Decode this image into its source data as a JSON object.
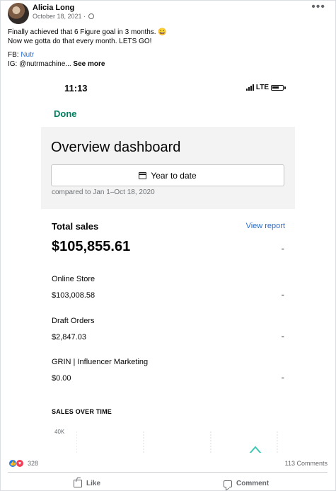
{
  "post": {
    "author": "Alicia Long",
    "date": "October 18, 2021 ·",
    "caption_line1": "Finally achieved that 6 Figure goal in 3 months. 😀",
    "caption_line2": "Now we gotta do that every month. LETS GO!",
    "fb_label": "FB: ",
    "fb_link": "Nutr",
    "ig_text": "IG: @nutrmachine...",
    "see_more": "See more",
    "menu_icon": "more-icon"
  },
  "screenshot": {
    "status_time": "11:13",
    "network": "LTE",
    "done": "Done",
    "title": "Overview dashboard",
    "date_filter": "Year to date",
    "comparison": "compared to Jan 1–Oct 18, 2020",
    "total_sales_label": "Total sales",
    "view_report": "View report",
    "total_sales_value": "$105,855.61",
    "total_sales_trend": "-",
    "rows": [
      {
        "label": "Online Store",
        "value": "$103,008.58",
        "trend": "-"
      },
      {
        "label": "Draft Orders",
        "value": "$2,847.03",
        "trend": "-"
      },
      {
        "label": "GRIN | Influencer Marketing",
        "value": "$0.00",
        "trend": "-"
      }
    ],
    "chart_title": "SALES OVER TIME",
    "chart_y_top": "40K"
  },
  "engagement": {
    "reaction_count": "328",
    "comment_count": "113 Comments",
    "like_label": "Like",
    "comment_label": "Comment"
  },
  "colors": {
    "shopify_green": "#008060",
    "link_blue": "#216fdb",
    "facebook_blue": "#1877f2",
    "love_red": "#f33e58"
  }
}
